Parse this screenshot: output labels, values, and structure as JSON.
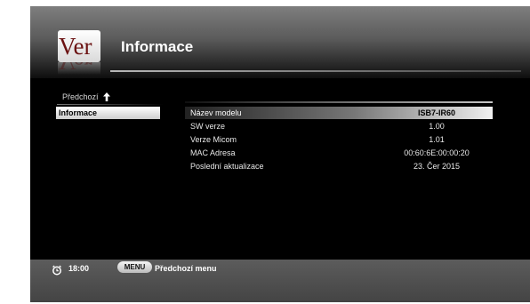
{
  "header": {
    "logo_text": "Ver",
    "title": "Informace"
  },
  "nav": {
    "previous_label": "Předchozí",
    "selected_item": "Informace"
  },
  "info": {
    "rows": [
      {
        "label": "Název modelu",
        "value": "ISB7-IR60",
        "selected": true
      },
      {
        "label": "SW verze",
        "value": "1.00"
      },
      {
        "label": "Verze Micom",
        "value": "1.01"
      },
      {
        "label": "MAC Adresa",
        "value": "00:60:6E:00:00:20"
      },
      {
        "label": "Poslední aktualizace",
        "value": "23. Čer 2015"
      }
    ]
  },
  "footer": {
    "time": "18:00",
    "menu_key": "MENU",
    "menu_hint": "Předchozí menu"
  },
  "icons": {
    "up_arrow": "up-arrow-icon",
    "clock": "clock-icon"
  }
}
